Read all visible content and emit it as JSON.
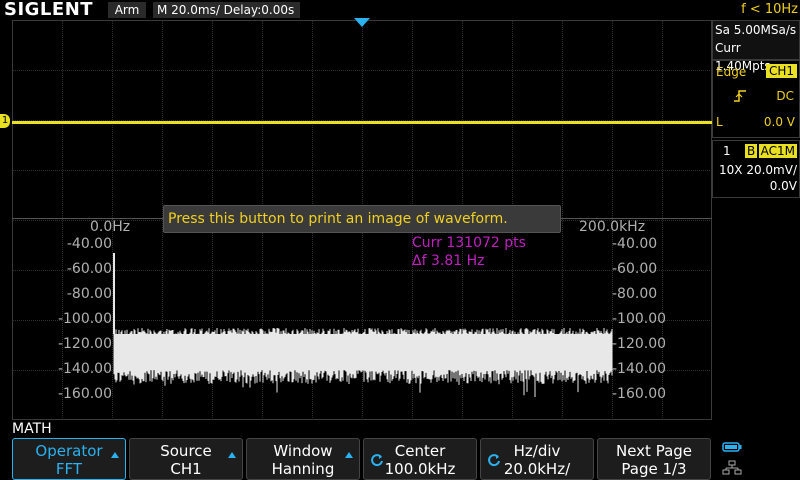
{
  "header": {
    "logo": "SIGLENT",
    "run_state": "Arm",
    "timebase": "M 20.0ms/ Delay:0.00s"
  },
  "right_panel": {
    "freq_counter": "f < 10Hz",
    "sample_rate": "Sa 5.00MSa/s",
    "memory": "Curr 1.40Mpts",
    "trigger_type": "Edge",
    "trigger_source": "CH1",
    "trigger_coupling": "DC",
    "trigger_mode": "L",
    "trigger_level": "0.0 V",
    "ch_num": "1",
    "ch_bw": "B",
    "ch_coupling": "AC1M",
    "probe": "10X",
    "vdiv": "20.0mV/",
    "offset": "0.0V"
  },
  "tooltip": "Press this button to print an image of waveform.",
  "fft": {
    "x_start": "0.0Hz",
    "x_end": "200.0kHz",
    "points": "Curr 131072 pts",
    "resolution": "Δf 3.81 Hz",
    "y_ticks": [
      "-40.00",
      "-60.00",
      "-80.00",
      "-100.00",
      "-120.00",
      "-140.00",
      "-160.00"
    ],
    "colors": {
      "ch1": "#e8e020",
      "fft": "#e8e8e8",
      "math": "#c020c0",
      "accent": "#2ab1f0"
    }
  },
  "menu": {
    "title": "MATH",
    "buttons": [
      {
        "line1": "Operator",
        "line2": "FFT"
      },
      {
        "line1": "Source",
        "line2": "CH1"
      },
      {
        "line1": "Window",
        "line2": "Hanning"
      },
      {
        "line1": "Center",
        "line2": "100.0kHz"
      },
      {
        "line1": "Hz/div",
        "line2": "20.0kHz/"
      },
      {
        "line1": "Next Page",
        "line2": "Page 1/3"
      }
    ]
  },
  "channel_marker": "1"
}
